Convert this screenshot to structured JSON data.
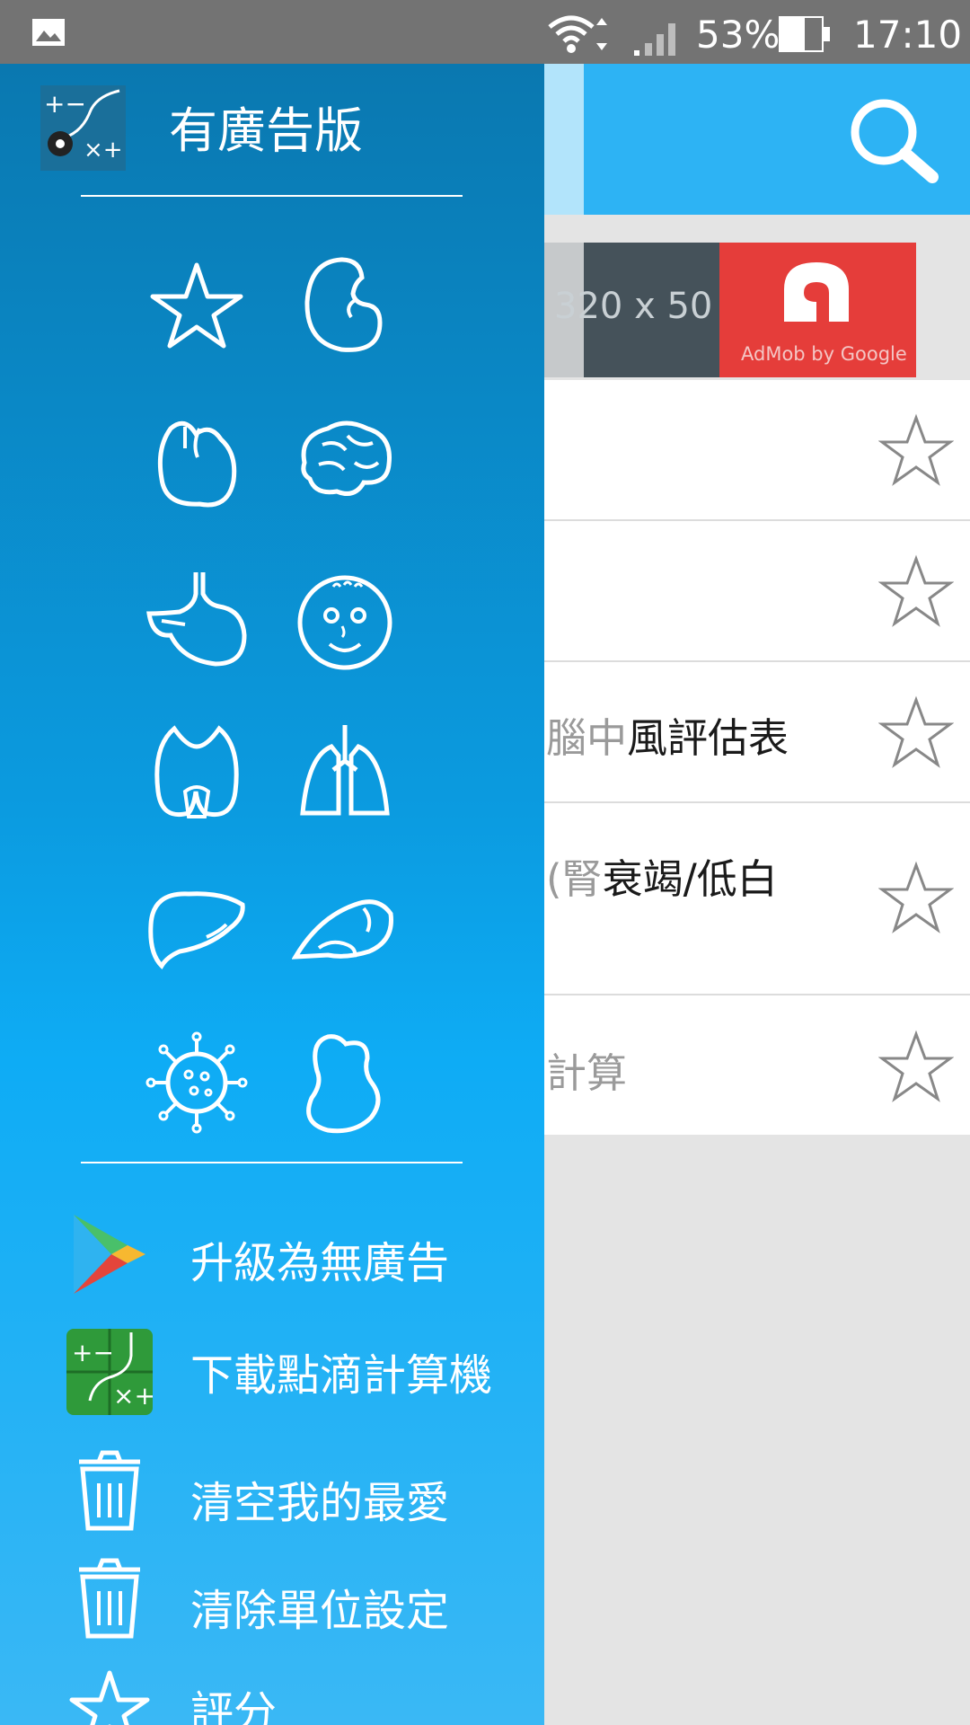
{
  "status_bar": {
    "battery_percent": "53%",
    "time": "17:10",
    "icons": [
      "gallery-icon",
      "wifi-icon",
      "signal-icon",
      "battery-icon"
    ]
  },
  "drawer": {
    "app_title": "有廣告版",
    "categories": [
      {
        "name": "favorites-star"
      },
      {
        "name": "kidney"
      },
      {
        "name": "heart"
      },
      {
        "name": "brain"
      },
      {
        "name": "stomach"
      },
      {
        "name": "baby-face"
      },
      {
        "name": "thyroid"
      },
      {
        "name": "lungs"
      },
      {
        "name": "liver"
      },
      {
        "name": "pancreas"
      },
      {
        "name": "virus"
      },
      {
        "name": "uterus"
      }
    ],
    "menu": [
      {
        "label": "升級為無廣告",
        "icon": "play-store-icon"
      },
      {
        "label": "下載點滴計算機",
        "icon": "drip-calculator-icon"
      },
      {
        "label": "清空我的最愛",
        "icon": "trash-icon"
      },
      {
        "label": "清除單位設定",
        "icon": "trash-icon"
      },
      {
        "label": "評分",
        "icon": "star-icon"
      }
    ]
  },
  "main": {
    "ad": {
      "size_text": "320 x 50",
      "brand": "AdMob by Google"
    },
    "rows": [
      {
        "faded": "",
        "text": ""
      },
      {
        "faded": "",
        "text": ""
      },
      {
        "faded": "腦中",
        "text": "風評估表"
      },
      {
        "faded": "(腎",
        "text": "衰竭/低白"
      },
      {
        "faded": "計算",
        "text": ""
      }
    ]
  },
  "colors": {
    "drawer_top": "#0a78b0",
    "drawer_bottom": "#3ab8f5",
    "app_bar": "#2db3f4",
    "status_bar": "#737373",
    "admob_red": "#e53d3a"
  }
}
